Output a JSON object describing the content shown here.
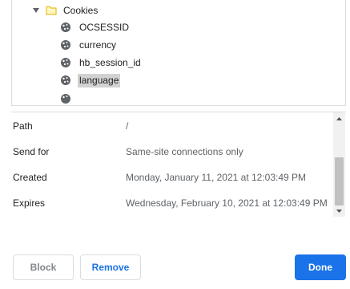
{
  "tree": {
    "folder": {
      "label": "Cookies",
      "icon": "folder-icon",
      "expanded": true
    },
    "cookies": [
      {
        "label": "OCSESSID",
        "icon": "cookie-icon",
        "selected": false
      },
      {
        "label": "currency",
        "icon": "cookie-icon",
        "selected": false
      },
      {
        "label": "hb_session_id",
        "icon": "cookie-icon",
        "selected": false
      },
      {
        "label": "language",
        "icon": "cookie-icon",
        "selected": true
      }
    ]
  },
  "details": [
    {
      "key": "Path",
      "value": "/"
    },
    {
      "key": "Send for",
      "value": "Same-site connections only"
    },
    {
      "key": "Created",
      "value": "Monday, January 11, 2021 at 12:03:49 PM"
    },
    {
      "key": "Expires",
      "value": "Wednesday, February 10, 2021 at 12:03:49 PM"
    }
  ],
  "buttons": {
    "block": "Block",
    "remove": "Remove",
    "done": "Done"
  },
  "colors": {
    "primary": "#1a73e8",
    "selected_bg": "#d2d2d2",
    "folder": "#f5c518",
    "icon": "#5f6368"
  }
}
